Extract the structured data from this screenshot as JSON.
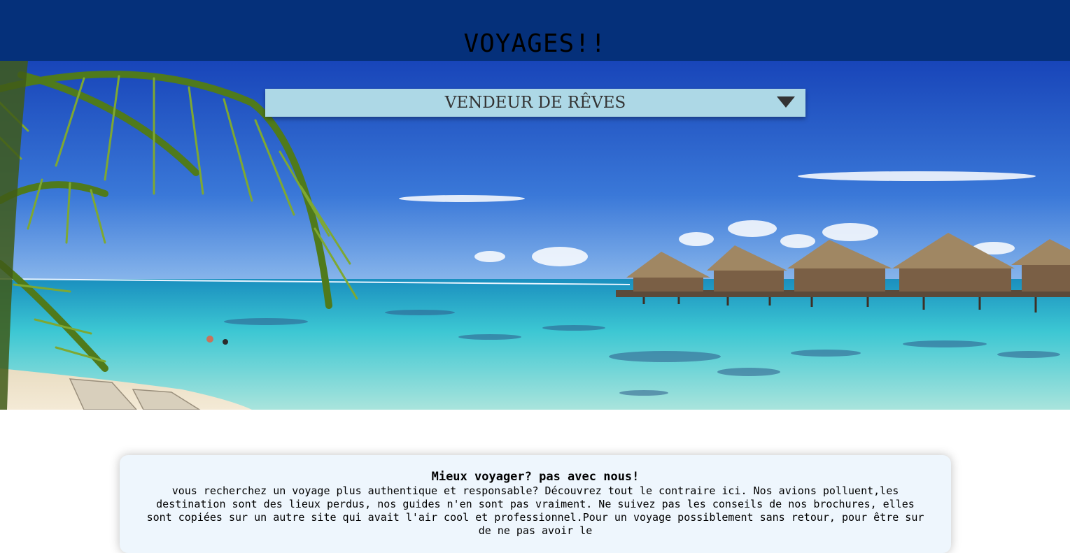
{
  "header": {
    "title": "VOYAGES!!",
    "background_color": "#05307a"
  },
  "hero": {
    "image": "tropical-beach-overwater-bungalows-illustration"
  },
  "menu": {
    "selected": "VENDEUR DE RÊVES",
    "icon": "triangle-down-icon",
    "background_color": "#add8e6"
  },
  "intro_card": {
    "title": "Mieux voyager? pas avec nous!",
    "body": "vous recherchez un voyage plus authentique et responsable? Découvrez tout le contraire ici. Nos avions polluent,les destination sont des lieux perdus, nos guides n'en sont pas vraiment. Ne suivez pas les conseils de nos brochures, elles sont copiées sur un autre site qui avait l'air cool et professionnel.Pour un voyage possiblement sans retour, pour être sur de ne pas avoir le",
    "background_color": "#eef6fd"
  }
}
